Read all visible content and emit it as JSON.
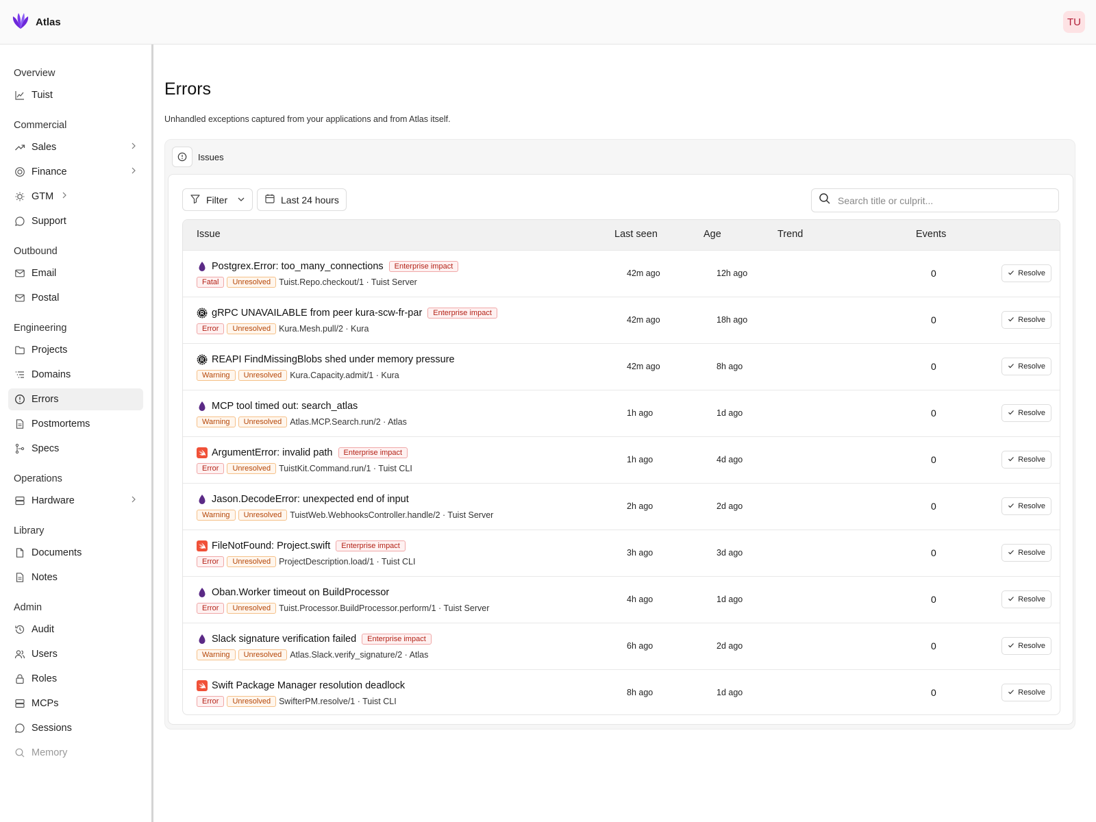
{
  "app": {
    "name": "Atlas",
    "user_initials": "TU"
  },
  "sidebar": {
    "sections": [
      {
        "heading": "Overview",
        "items": [
          {
            "label": "Tuist",
            "icon": "chart-icon",
            "chevron": false
          }
        ]
      },
      {
        "heading": "Commercial",
        "items": [
          {
            "label": "Sales",
            "icon": "trend-icon",
            "chevron": true
          },
          {
            "label": "Finance",
            "icon": "coins-icon",
            "chevron": true
          },
          {
            "label": "GTM",
            "icon": "bulb-icon",
            "chevron": true
          },
          {
            "label": "Support",
            "icon": "chat-icon",
            "chevron": false
          }
        ]
      },
      {
        "heading": "Outbound",
        "items": [
          {
            "label": "Email",
            "icon": "mail-icon",
            "chevron": false
          },
          {
            "label": "Postal",
            "icon": "mail-icon",
            "chevron": false
          }
        ]
      },
      {
        "heading": "Engineering",
        "items": [
          {
            "label": "Projects",
            "icon": "folder-icon",
            "chevron": false
          },
          {
            "label": "Domains",
            "icon": "list-icon",
            "chevron": false
          },
          {
            "label": "Errors",
            "icon": "alert-circle-icon",
            "chevron": false,
            "active": true
          },
          {
            "label": "Postmortems",
            "icon": "document-icon",
            "chevron": false
          },
          {
            "label": "Specs",
            "icon": "git-icon",
            "chevron": false
          }
        ]
      },
      {
        "heading": "Operations",
        "items": [
          {
            "label": "Hardware",
            "icon": "server-icon",
            "chevron": true
          }
        ]
      },
      {
        "heading": "Library",
        "items": [
          {
            "label": "Documents",
            "icon": "file-icon",
            "chevron": false
          },
          {
            "label": "Notes",
            "icon": "document-icon",
            "chevron": false
          }
        ]
      },
      {
        "heading": "Admin",
        "items": [
          {
            "label": "Audit",
            "icon": "history-icon",
            "chevron": false
          },
          {
            "label": "Users",
            "icon": "users-icon",
            "chevron": false
          },
          {
            "label": "Roles",
            "icon": "lock-icon",
            "chevron": false
          },
          {
            "label": "MCPs",
            "icon": "server-icon",
            "chevron": false
          },
          {
            "label": "Sessions",
            "icon": "chat-icon",
            "chevron": false
          },
          {
            "label": "Memory",
            "icon": "search-icon",
            "chevron": false,
            "faded": true
          }
        ]
      }
    ]
  },
  "page": {
    "title": "Errors",
    "subtitle": "Unhandled exceptions captured from your applications and from Atlas itself.",
    "panel_label": "Issues"
  },
  "toolbar": {
    "filter_label": "Filter",
    "range_label": "Last 24 hours",
    "search_placeholder": "Search title or culprit..."
  },
  "table": {
    "columns": {
      "issue": "Issue",
      "last_seen": "Last seen",
      "age": "Age",
      "trend": "Trend",
      "events": "Events"
    },
    "resolve_label": "Resolve",
    "unresolved_label": "Unresolved",
    "impact_label": "Enterprise impact",
    "rows": [
      {
        "lang": "elixir",
        "title": "Postgrex.Error: too_many_connections",
        "impact": true,
        "level": "Fatal",
        "culprit": "Tuist.Repo.checkout/1 · Tuist Server",
        "last_seen": "42m ago",
        "age": "12h ago",
        "events": "0"
      },
      {
        "lang": "rust",
        "title": "gRPC UNAVAILABLE from peer kura-scw-fr-par",
        "impact": true,
        "level": "Error",
        "culprit": "Kura.Mesh.pull/2 · Kura",
        "last_seen": "42m ago",
        "age": "18h ago",
        "events": "0"
      },
      {
        "lang": "rust",
        "title": "REAPI FindMissingBlobs shed under memory pressure",
        "impact": false,
        "level": "Warning",
        "culprit": "Kura.Capacity.admit/1 · Kura",
        "last_seen": "42m ago",
        "age": "8h ago",
        "events": "0"
      },
      {
        "lang": "elixir",
        "title": "MCP tool timed out: search_atlas",
        "impact": false,
        "level": "Warning",
        "culprit": "Atlas.MCP.Search.run/2 · Atlas",
        "last_seen": "1h ago",
        "age": "1d ago",
        "events": "0"
      },
      {
        "lang": "swift",
        "title": "ArgumentError: invalid path",
        "impact": true,
        "level": "Error",
        "culprit": "TuistKit.Command.run/1 · Tuist CLI",
        "last_seen": "1h ago",
        "age": "4d ago",
        "events": "0"
      },
      {
        "lang": "elixir",
        "title": "Jason.DecodeError: unexpected end of input",
        "impact": false,
        "level": "Warning",
        "culprit": "TuistWeb.WebhooksController.handle/2 · Tuist Server",
        "last_seen": "2h ago",
        "age": "2d ago",
        "events": "0"
      },
      {
        "lang": "swift",
        "title": "FileNotFound: Project.swift",
        "impact": true,
        "level": "Error",
        "culprit": "ProjectDescription.load/1 · Tuist CLI",
        "last_seen": "3h ago",
        "age": "3d ago",
        "events": "0"
      },
      {
        "lang": "elixir",
        "title": "Oban.Worker timeout on BuildProcessor",
        "impact": false,
        "level": "Error",
        "culprit": "Tuist.Processor.BuildProcessor.perform/1 · Tuist Server",
        "last_seen": "4h ago",
        "age": "1d ago",
        "events": "0"
      },
      {
        "lang": "elixir",
        "title": "Slack signature verification failed",
        "impact": true,
        "level": "Warning",
        "culprit": "Atlas.Slack.verify_signature/2 · Atlas",
        "last_seen": "6h ago",
        "age": "2d ago",
        "events": "0"
      },
      {
        "lang": "swift",
        "title": "Swift Package Manager resolution deadlock",
        "impact": false,
        "level": "Error",
        "culprit": "SwifterPM.resolve/1 · Tuist CLI",
        "last_seen": "8h ago",
        "age": "1d ago",
        "events": "0"
      }
    ]
  }
}
